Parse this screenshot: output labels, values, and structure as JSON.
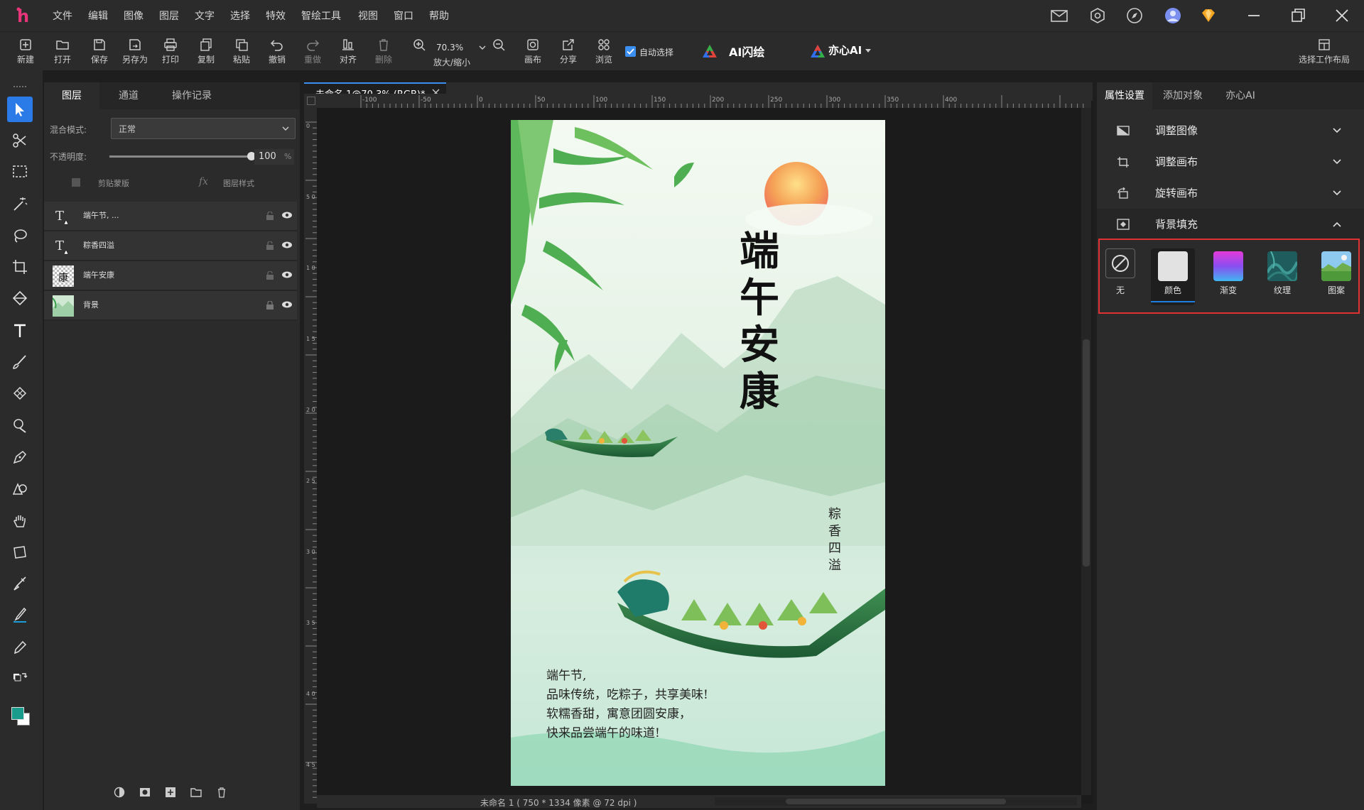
{
  "menu": [
    "文件",
    "编辑",
    "图像",
    "图层",
    "文字",
    "选择",
    "特效",
    "智绘工具",
    "视图",
    "窗口",
    "帮助"
  ],
  "toolbar": {
    "new": "新建",
    "open": "打开",
    "save": "保存",
    "save_as": "另存为",
    "print": "打印",
    "copy": "复制",
    "paste": "粘贴",
    "undo": "撤销",
    "redo": "重做",
    "align": "对齐",
    "delete": "删除",
    "zoom_value": "70.3%",
    "zoom_label": "放大/缩小",
    "canvas": "画布",
    "share": "分享",
    "browse": "浏览",
    "auto_select": "自动选择",
    "ai_flash": "AI闪绘",
    "yixin_ai": "亦心AI",
    "workspace": "选择工作布局"
  },
  "layers_panel": {
    "tabs": [
      "图层",
      "通道",
      "操作记录"
    ],
    "blend_label": "混合模式:",
    "blend_value": "正常",
    "opacity_label": "不透明度:",
    "opacity_value": "100",
    "opacity_unit": "%",
    "opacity_fraction": 1.0,
    "clip_mask": "剪贴蒙版",
    "layer_style": "图层样式",
    "layers": [
      {
        "name": "端午节, ..."
      },
      {
        "name": "粽香四溢"
      },
      {
        "name": "端午安康"
      },
      {
        "name": "背景"
      }
    ]
  },
  "document": {
    "tab_title": "未命名 1@70.3% (RGB)*",
    "status": "未命名 1 ( 750 * 1334 像素 @ 72 dpi )",
    "ruler_top": [
      "-100",
      "-50",
      "0",
      "50",
      "100",
      "150",
      "200",
      "250",
      "300",
      "350",
      "400"
    ],
    "ruler_left": [
      "0",
      "5 0",
      "1 0 0",
      "1 5 0",
      "2 0 0",
      "2 5 0",
      "3 0 0",
      "3 5 0",
      "4 0 0",
      "4 5 0"
    ]
  },
  "poster": {
    "title_chars": [
      "端",
      "午",
      "安",
      "康"
    ],
    "subtitle_chars": [
      "粽",
      "香",
      "四",
      "溢"
    ],
    "body_lines": [
      "端午节,",
      "品味传统，吃粽子，共享美味!",
      "软糯香甜，寓意团圆安康，",
      "快来品尝端午的味道!"
    ]
  },
  "right_panel": {
    "tabs": [
      "属性设置",
      "添加对象",
      "亦心AI"
    ],
    "sections": [
      {
        "label": "调整图像",
        "expanded": false
      },
      {
        "label": "调整画布",
        "expanded": false
      },
      {
        "label": "旋转画布",
        "expanded": false
      },
      {
        "label": "背景填充",
        "expanded": true
      }
    ],
    "fill_options": [
      "无",
      "颜色",
      "渐变",
      "纹理",
      "图案"
    ],
    "fill_selected": "颜色"
  },
  "colors": {
    "accent": "#1e7fe0",
    "highlight_border": "#e03232",
    "fg_color": "#1a9c8c",
    "bg_color": "#ffffff"
  }
}
